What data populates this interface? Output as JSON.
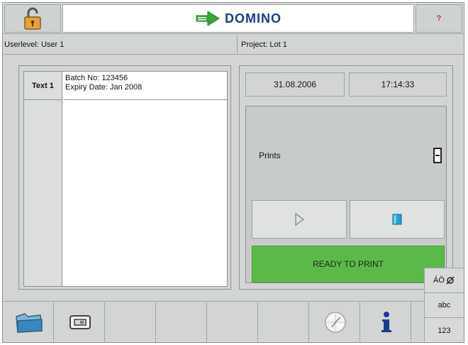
{
  "header": {
    "lock_icon": "open-padlock-icon",
    "logo_text": "DOMINO",
    "logo_icon": "domino-arrow-icon",
    "help_label": "?"
  },
  "infobar": {
    "userlevel": "Userlevel: User 1",
    "project": "Project: Lot 1"
  },
  "message": {
    "fields": [
      {
        "name": "Text 1",
        "lines": [
          "Batch No: 123456",
          "Expiry Date: Jan 2008"
        ]
      }
    ]
  },
  "status": {
    "date": "31.08.2006",
    "time": "17:14:33",
    "prints_label": "Prints",
    "prints_count": "0",
    "ready_label": "READY TO PRINT",
    "colors": {
      "ready": "#5bb94a",
      "logo": "#1b3a93",
      "logo_arrow": "#3aa536"
    }
  },
  "toolbar": {
    "buttons": [
      {
        "icon": "folder-icon"
      },
      {
        "icon": "printer-icon"
      },
      {
        "icon": "blank"
      },
      {
        "icon": "blank"
      },
      {
        "icon": "blank"
      },
      {
        "icon": "blank"
      },
      {
        "icon": "clock-icon"
      },
      {
        "icon": "info-icon"
      }
    ]
  },
  "keyboard": {
    "modes": [
      "ÁÖ",
      "abc",
      "123"
    ]
  }
}
